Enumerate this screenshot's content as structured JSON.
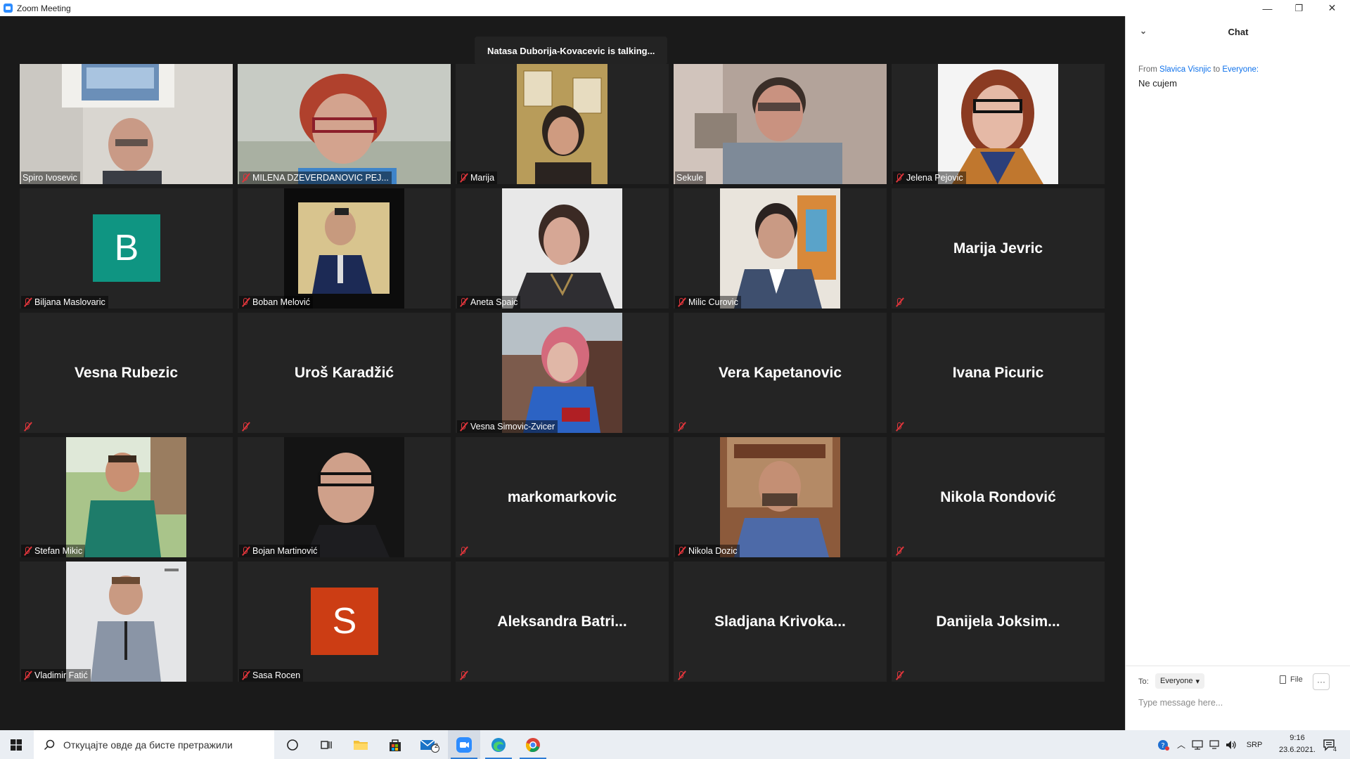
{
  "window": {
    "title": "Zoom Meeting",
    "minimize_glyph": "—",
    "restore_glyph": "❐",
    "close_glyph": "✕"
  },
  "meeting": {
    "talking_indicator": "Natasa Duborija-Kovacevic is talking..."
  },
  "participants": [
    {
      "name": "Spiro Ivosevic",
      "muted": false,
      "display": "photo"
    },
    {
      "name": "MILENA DZEVERDANOVIC PEJ...",
      "muted": true,
      "display": "photo"
    },
    {
      "name": "Marija",
      "muted": true,
      "display": "photo"
    },
    {
      "name": "Sekule",
      "muted": false,
      "display": "photo"
    },
    {
      "name": "Jelena Pejovic",
      "muted": true,
      "display": "photo"
    },
    {
      "name": "Biljana Maslovaric",
      "muted": true,
      "display": "avatar",
      "avatar_letter": "B",
      "avatar_color": "#0f9582"
    },
    {
      "name": "Boban Melović",
      "muted": true,
      "display": "photo"
    },
    {
      "name": "Aneta Spaic",
      "muted": true,
      "display": "photo"
    },
    {
      "name": "Milic Curovic",
      "muted": true,
      "display": "photo"
    },
    {
      "name": "",
      "display_name": "Marija Jevric",
      "muted": true,
      "display": "name"
    },
    {
      "name": "",
      "display_name": "Vesna Rubezic",
      "muted": true,
      "display": "name"
    },
    {
      "name": "",
      "display_name": "Uroš Karadžić",
      "muted": true,
      "display": "name"
    },
    {
      "name": "Vesna Simovic-Zvicer",
      "muted": true,
      "display": "photo"
    },
    {
      "name": "",
      "display_name": "Vera Kapetanovic",
      "muted": true,
      "display": "name"
    },
    {
      "name": "",
      "display_name": "Ivana Picuric",
      "muted": true,
      "display": "name"
    },
    {
      "name": "Stefan Mikic",
      "muted": true,
      "display": "photo"
    },
    {
      "name": "Bojan Martinović",
      "muted": true,
      "display": "photo"
    },
    {
      "name": "",
      "display_name": "markomarkovic",
      "muted": true,
      "display": "name"
    },
    {
      "name": "Nikola Dozic",
      "muted": true,
      "display": "photo"
    },
    {
      "name": "",
      "display_name": "Nikola Rondović",
      "muted": true,
      "display": "name"
    },
    {
      "name": "Vladimir Fatić",
      "muted": true,
      "display": "photo"
    },
    {
      "name": "Sasa Rocen",
      "muted": true,
      "display": "avatar",
      "avatar_letter": "S",
      "avatar_color": "#cc3d14"
    },
    {
      "name": "",
      "display_name": "Aleksandra  Batri...",
      "muted": true,
      "display": "name"
    },
    {
      "name": "",
      "display_name": "Sladjana  Krivoka...",
      "muted": true,
      "display": "name"
    },
    {
      "name": "",
      "display_name": "Danijela  Joksim...",
      "muted": true,
      "display": "name"
    }
  ],
  "chat": {
    "title": "Chat",
    "message": {
      "from_prefix": "From",
      "sender": "Slavica Visnjic",
      "to_word": "to",
      "recipient": "Everyone:",
      "text": "Ne cujem"
    },
    "to_label": "To:",
    "recipient_select": "Everyone",
    "file_label": "File",
    "more_label": "···",
    "input_placeholder": "Type message here..."
  },
  "taskbar": {
    "search_placeholder": "Откуцајте овде да бисте претражили",
    "mail_badge": "2",
    "language": "SRP",
    "time": "9:16",
    "date": "23.6.2021.",
    "notifications_count": "4"
  },
  "colors": {
    "accent_blue": "#0e71eb",
    "tile_bg": "#242424",
    "meeting_bg": "#1a1a1a",
    "mute_red": "#e0353b"
  }
}
